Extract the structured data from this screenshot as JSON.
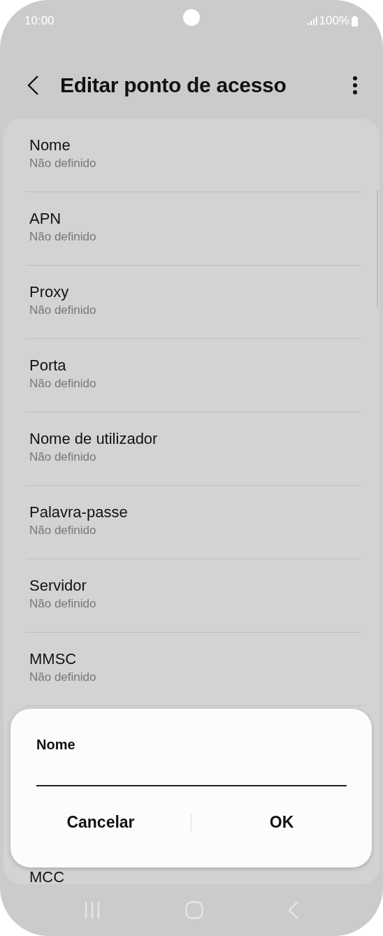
{
  "status_bar": {
    "time": "10:00",
    "battery": "100%"
  },
  "header": {
    "title": "Editar ponto de acesso"
  },
  "settings": [
    {
      "title": "Nome",
      "value": "Não definido"
    },
    {
      "title": "APN",
      "value": "Não definido"
    },
    {
      "title": "Proxy",
      "value": "Não definido"
    },
    {
      "title": "Porta",
      "value": "Não definido"
    },
    {
      "title": "Nome de utilizador",
      "value": "Não definido"
    },
    {
      "title": "Palavra-passe",
      "value": "Não definido"
    },
    {
      "title": "Servidor",
      "value": "Não definido"
    },
    {
      "title": "MMSC",
      "value": "Não definido"
    }
  ],
  "covered_setting": {
    "title": "MCC"
  },
  "dialog": {
    "title": "Nome",
    "buttons": [
      "Cancelar",
      "OK"
    ]
  }
}
